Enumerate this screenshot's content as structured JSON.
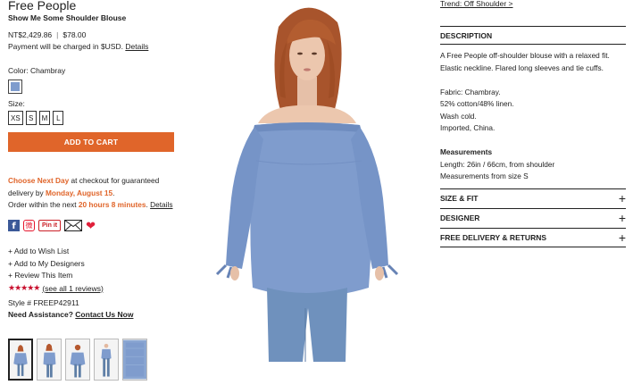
{
  "product": {
    "brand": "Free People",
    "name": "Show Me Some Shoulder Blouse",
    "price_local": "NT$2,429.86",
    "price_usd": "$78.00",
    "payment_text": "Payment will be charged in $USD.",
    "payment_link": "Details",
    "color_label": "Color: Chambray",
    "swatch_color": "#7f9ccd",
    "size_label": "Size:",
    "sizes": [
      "XS",
      "S",
      "M",
      "L"
    ],
    "add_to_cart": "ADD TO CART"
  },
  "shipping": {
    "choose": "Choose Next Day",
    "choose_rest": " at checkout for guaranteed delivery by ",
    "date": "Monday, August 15",
    "period": ".",
    "order_prefix": "Order within the next ",
    "countdown": "20 hours 8 minutes",
    "order_suffix": ". ",
    "details_link": "Details"
  },
  "social": {
    "pinit": "Pin it"
  },
  "actions": [
    "+ Add to Wish List",
    "+ Add to My Designers",
    "+ Review This Item"
  ],
  "rating": {
    "stars": "★★★★★",
    "reviews_link": "(see all 1 reviews)"
  },
  "style_number": "Style # FREEP42911",
  "assistance": {
    "label": "Need Assistance?",
    "link": "Contact Us Now"
  },
  "right": {
    "trend": "Trend: Off Shoulder >",
    "description_title": "DESCRIPTION",
    "description_lines": [
      "A Free People off-shoulder blouse with a relaxed fit.",
      "Elastic neckline. Flared long sleeves and tie cuffs.",
      "",
      "Fabric: Chambray.",
      "52% cotton/48% linen.",
      "Wash cold.",
      "Imported, China.",
      ""
    ],
    "measurements_title": "Measurements",
    "measurements_lines": [
      "Length: 26in / 66cm, from shoulder",
      "Measurements from size S"
    ],
    "sections": [
      "SIZE & FIT",
      "DESIGNER",
      "FREE DELIVERY & RETURNS"
    ]
  },
  "colors": {
    "accent": "#e0652a",
    "chambray": "#7f9ccd"
  }
}
